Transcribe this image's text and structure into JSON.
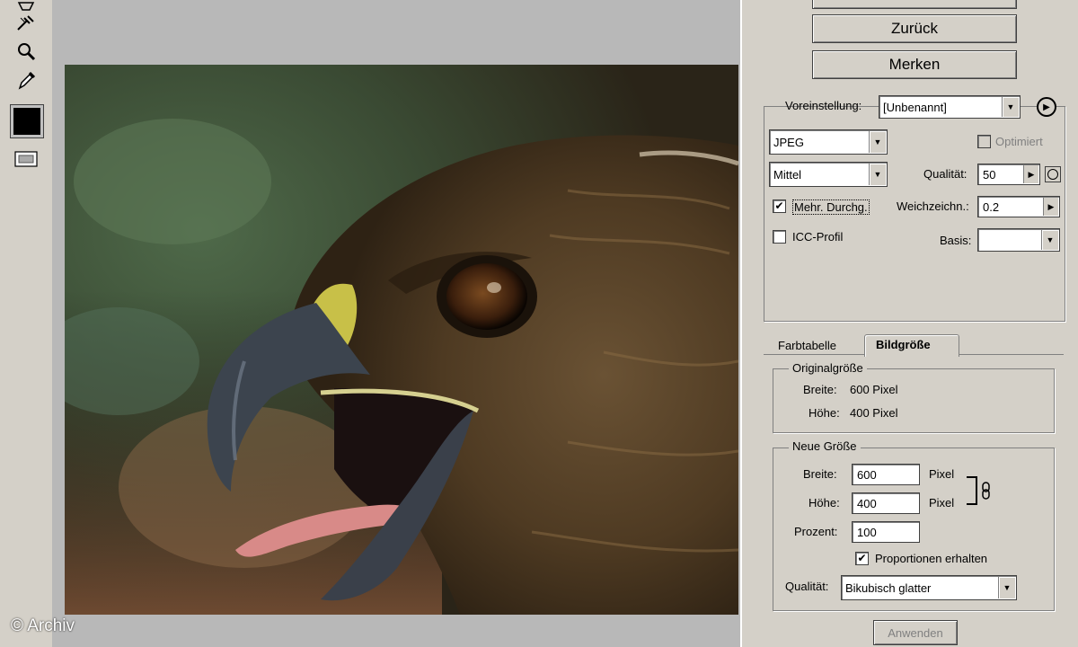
{
  "toolbar": {
    "icons": [
      "slice-select-icon",
      "eyedropper-icon",
      "zoom-icon",
      "color-picker-icon",
      "color-swatch",
      "preview-icon"
    ]
  },
  "watermark": "© Archiv",
  "buttons": {
    "back": "Zurück",
    "remember": "Merken",
    "apply": "Anwenden"
  },
  "settings": {
    "preset_label": "Voreinstellung:",
    "preset_value": "[Unbenannt]",
    "format": "JPEG",
    "quality_level": "Mittel",
    "optimized_label": "Optimiert",
    "quality_label": "Qualität:",
    "quality_value": "50",
    "progressive_label": "Mehr. Durchg.",
    "blur_label": "Weichzeichn.:",
    "blur_value": "0.2",
    "icc_label": "ICC-Profil",
    "matte_label": "Basis:",
    "matte_value": ""
  },
  "tabs": {
    "color_table": "Farbtabelle",
    "image_size": "Bildgröße"
  },
  "original_size": {
    "legend": "Originalgröße",
    "width_label": "Breite:",
    "width_value": "600 Pixel",
    "height_label": "Höhe:",
    "height_value": "400 Pixel"
  },
  "new_size": {
    "legend": "Neue Größe",
    "width_label": "Breite:",
    "width_value": "600",
    "width_unit": "Pixel",
    "height_label": "Höhe:",
    "height_value": "400",
    "height_unit": "Pixel",
    "percent_label": "Prozent:",
    "percent_value": "100",
    "constrain_label": "Proportionen erhalten",
    "quality_label": "Qualität:",
    "quality_value": "Bikubisch glatter"
  },
  "colors": {
    "panel": "#d4d0c8",
    "canvas_bg": "#b8b8b8",
    "swatch": "#000000"
  }
}
